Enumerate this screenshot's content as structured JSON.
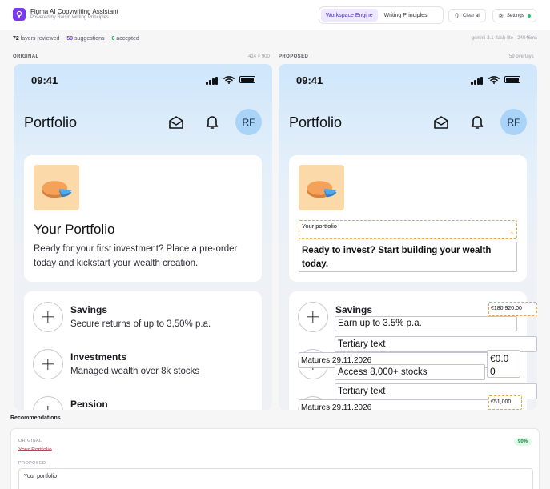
{
  "header": {
    "app_title": "Figma AI Copywriting Assistant",
    "app_subtitle": "Powered by Raisin Writing Principles",
    "tabs": [
      {
        "label": "Workspace Engine",
        "active": true
      },
      {
        "label": "Writing Principles",
        "active": false
      }
    ],
    "clear_all": "Clear all",
    "settings": "Settings"
  },
  "stats": {
    "layers_count": "72",
    "layers_label": "layers reviewed",
    "suggestions_count": "59",
    "suggestions_label": "suggestions",
    "accepted_count": "0",
    "accepted_label": "accepted",
    "model": "gemini-3.1-flash-lite · 24046ms"
  },
  "original": {
    "label": "ORIGINAL",
    "meta": "414 × 900",
    "time": "09:41",
    "title": "Portfolio",
    "avatar": "RF",
    "card_title": "Your Portfolio",
    "card_body": "Ready for your first investment? Place a pre-order today and kickstart your wealth creation.",
    "rows": [
      {
        "title": "Savings",
        "sub": "Secure returns of up to 3,50% p.a."
      },
      {
        "title": "Investments",
        "sub": "Managed wealth over 8k stocks"
      },
      {
        "title": "Pension",
        "sub": ""
      }
    ]
  },
  "proposed": {
    "label": "PROPOSED",
    "meta": "59 overlays",
    "time": "09:41",
    "title": "Portfolio",
    "avatar": "RF",
    "overlay_title": "Your portfolio",
    "overlay_body": "Ready to invest? Start building your wealth today.",
    "row1_title": "Savings",
    "row1_sub": "Earn up to 3.5% p.a.",
    "row1_amount": "€180,920.00",
    "tertiary1": "Tertiary text",
    "matures1": "Matures 29.11.2026",
    "amount2": "€0.0\n0",
    "row2_sub": "Access 8,000+ stocks",
    "tertiary2": "Tertiary text",
    "matures2": "Matures 29.11.2026",
    "amount3": "€51,000."
  },
  "recommendations": {
    "heading": "Recommendations",
    "original_key": "ORIGINAL",
    "original_value": "Your Portfolio",
    "badge": "90%",
    "proposed_key": "PROPOSED",
    "proposed_value": "Your portfolio"
  },
  "colors": {
    "accent": "#7c3aed",
    "avatar_bg": "#a9d4f8",
    "warn": "#e7a84a",
    "success": "#22c55e"
  }
}
